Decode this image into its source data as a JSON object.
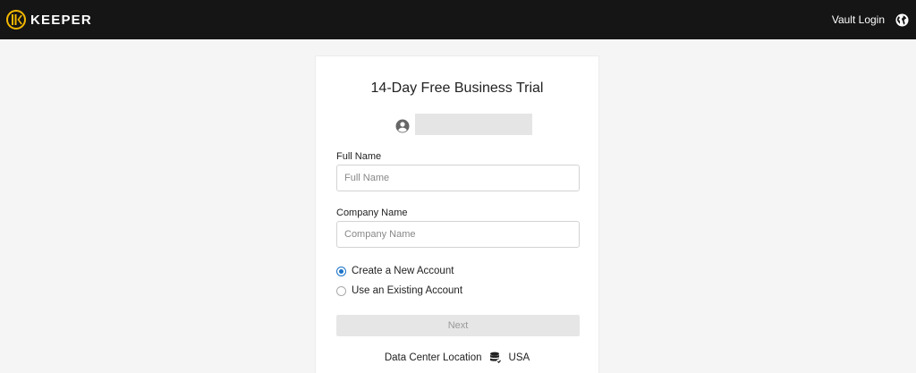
{
  "header": {
    "brand": "KEEPER",
    "vault_login": "Vault Login",
    "icons": {
      "logo": "keeper-logo-icon",
      "language": "globe-icon"
    }
  },
  "form": {
    "title": "14-Day Free Business Trial",
    "full_name": {
      "label": "Full Name",
      "placeholder": "Full Name",
      "value": ""
    },
    "company_name": {
      "label": "Company Name",
      "placeholder": "Company Name",
      "value": ""
    },
    "account_options": [
      {
        "label": "Create a New Account",
        "selected": true
      },
      {
        "label": "Use an Existing Account",
        "selected": false
      }
    ],
    "next_label": "Next",
    "data_center": {
      "label": "Data Center Location",
      "value": "USA",
      "icon": "database-icon"
    },
    "user_icon": "user-circle-icon"
  },
  "colors": {
    "header_bg": "#151515",
    "logo_gold": "#f5b800",
    "radio_accent": "#1a73c8",
    "page_bg": "#f5f5f5"
  }
}
